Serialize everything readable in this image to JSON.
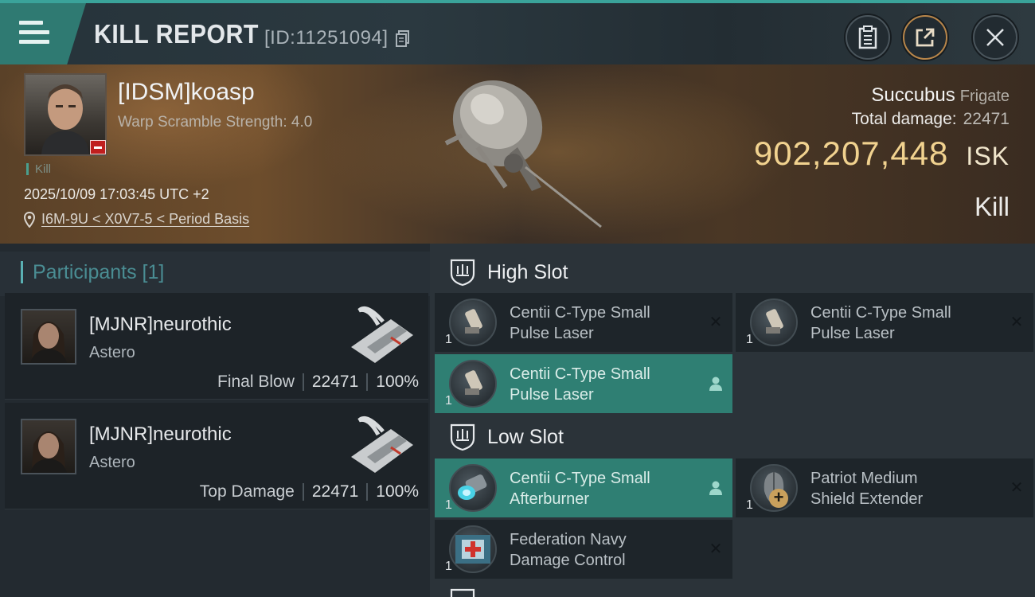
{
  "header": {
    "title": "KILL REPORT",
    "report_id": "[ID:11251094]",
    "icons": [
      "menu-icon",
      "copy-icon",
      "clipboard-icon",
      "share-icon",
      "close-icon"
    ],
    "accent_color": "#3aa39a"
  },
  "victim": {
    "name": "[IDSM]koasp",
    "warp_scramble": "Warp Scramble Strength: 4.0",
    "kill_tag": "Kill",
    "datetime": "2025/10/09 17:03:45 UTC +2",
    "location": "I6M-9U < X0V7-5 < Period Basis",
    "ship_name": "Succubus",
    "ship_class": "Frigate",
    "total_damage_label": "Total damage:",
    "total_damage": "22471",
    "isk_value": "902,207,448",
    "isk_unit": "ISK",
    "result": "Kill",
    "isk_color": "#f1d28f"
  },
  "participants": {
    "header": "Participants [1]",
    "rows": [
      {
        "name": "[MJNR]neurothic",
        "ship": "Astero",
        "label": "Final Blow",
        "damage": "22471",
        "percent": "100%"
      },
      {
        "name": "[MJNR]neurothic",
        "ship": "Astero",
        "label": "Top Damage",
        "damage": "22471",
        "percent": "100%"
      }
    ]
  },
  "fitting": {
    "high_slot": {
      "title": "High Slot",
      "modules": [
        {
          "name_line1": "Centii C-Type Small",
          "name_line2": "Pulse Laser",
          "qty": "1",
          "status": "destroyed"
        },
        {
          "name_line1": "Centii C-Type Small",
          "name_line2": "Pulse Laser",
          "qty": "1",
          "status": "destroyed"
        },
        {
          "name_line1": "Centii C-Type Small",
          "name_line2": "Pulse Laser",
          "qty": "1",
          "status": "dropped"
        }
      ]
    },
    "low_slot": {
      "title": "Low Slot",
      "modules": [
        {
          "name_line1": "Centii C-Type Small",
          "name_line2": "Afterburner",
          "qty": "1",
          "status": "dropped"
        },
        {
          "name_line1": "Patriot Medium",
          "name_line2": "Shield Extender",
          "qty": "1",
          "status": "destroyed"
        },
        {
          "name_line1": "Federation Navy",
          "name_line2": "Damage Control",
          "qty": "1",
          "status": "destroyed"
        }
      ]
    },
    "dropped_color": "#2f7f73"
  }
}
